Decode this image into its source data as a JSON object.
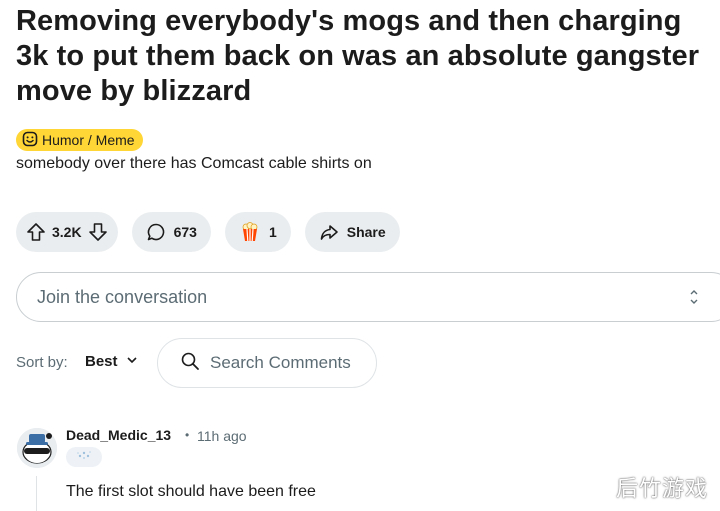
{
  "post": {
    "title": "Removing everybody's mogs and then charging 3k to put them back on was an absolute gangster move by blizzard",
    "flair": {
      "label": "Humor / Meme",
      "icon": "smiley-mask-icon",
      "color": "#ffd635"
    },
    "body": "somebody over there has Comcast cable shirts on"
  },
  "actions": {
    "vote_count": "3.2K",
    "comment_count": "673",
    "award_count": "1",
    "share_label": "Share"
  },
  "reply": {
    "placeholder": "Join the conversation"
  },
  "sort": {
    "label": "Sort by:",
    "value": "Best"
  },
  "search": {
    "placeholder": "Search Comments"
  },
  "comment": {
    "username": "Dead_Medic_13",
    "separator": "•",
    "time": "11h ago",
    "text": "The first slot should have been free"
  },
  "watermark": "后竹游戏"
}
